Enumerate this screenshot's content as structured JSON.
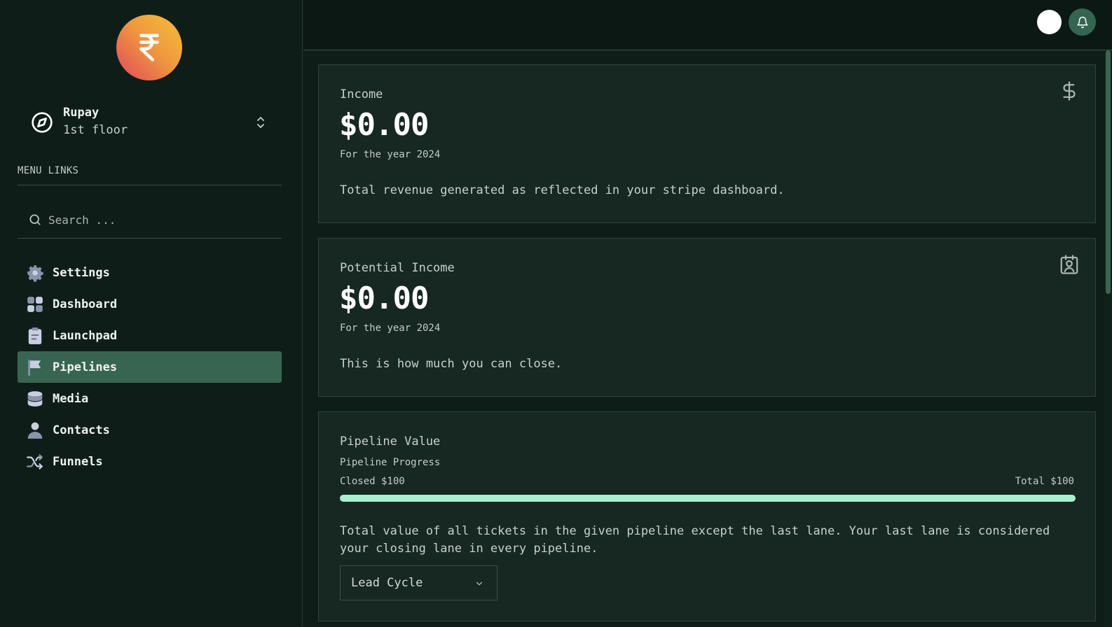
{
  "sidebar": {
    "logo_icon": "rupee-icon",
    "account": {
      "name": "Rupay",
      "location": "1st floor"
    },
    "menu_title": "MENU LINKS",
    "search": {
      "placeholder": "Search ..."
    },
    "items": [
      {
        "label": "Settings",
        "icon": "gear-icon"
      },
      {
        "label": "Dashboard",
        "icon": "grid-icon"
      },
      {
        "label": "Launchpad",
        "icon": "clipboard-icon"
      },
      {
        "label": "Pipelines",
        "icon": "flag-icon",
        "active": true
      },
      {
        "label": "Media",
        "icon": "database-icon"
      },
      {
        "label": "Contacts",
        "icon": "person-icon"
      },
      {
        "label": "Funnels",
        "icon": "shuffle-icon"
      }
    ]
  },
  "topbar": {
    "avatar": "user-avatar",
    "bell": "bell-icon"
  },
  "cards": {
    "income": {
      "title": "Income",
      "amount": "$0.00",
      "year": "For the year 2024",
      "desc": "Total revenue generated as reflected in your stripe dashboard.",
      "icon": "dollar-icon"
    },
    "potential": {
      "title": "Potential Income",
      "amount": "$0.00",
      "year": "For the year 2024",
      "desc": "This is how much you can close.",
      "icon": "contact-book-icon"
    },
    "pipeline": {
      "title": "Pipeline Value",
      "progress_label": "Pipeline Progress",
      "closed": "Closed $100",
      "total": "Total $100",
      "progress_fraction": 1.0,
      "desc": "Total value of all tickets in the given pipeline except the last lane. Your last lane is considered your closing lane in every pipeline.",
      "select_value": "Lead Cycle"
    }
  },
  "colors": {
    "accent": "#386551",
    "progress": "#a7f0cf",
    "background": "#0f1d19"
  }
}
